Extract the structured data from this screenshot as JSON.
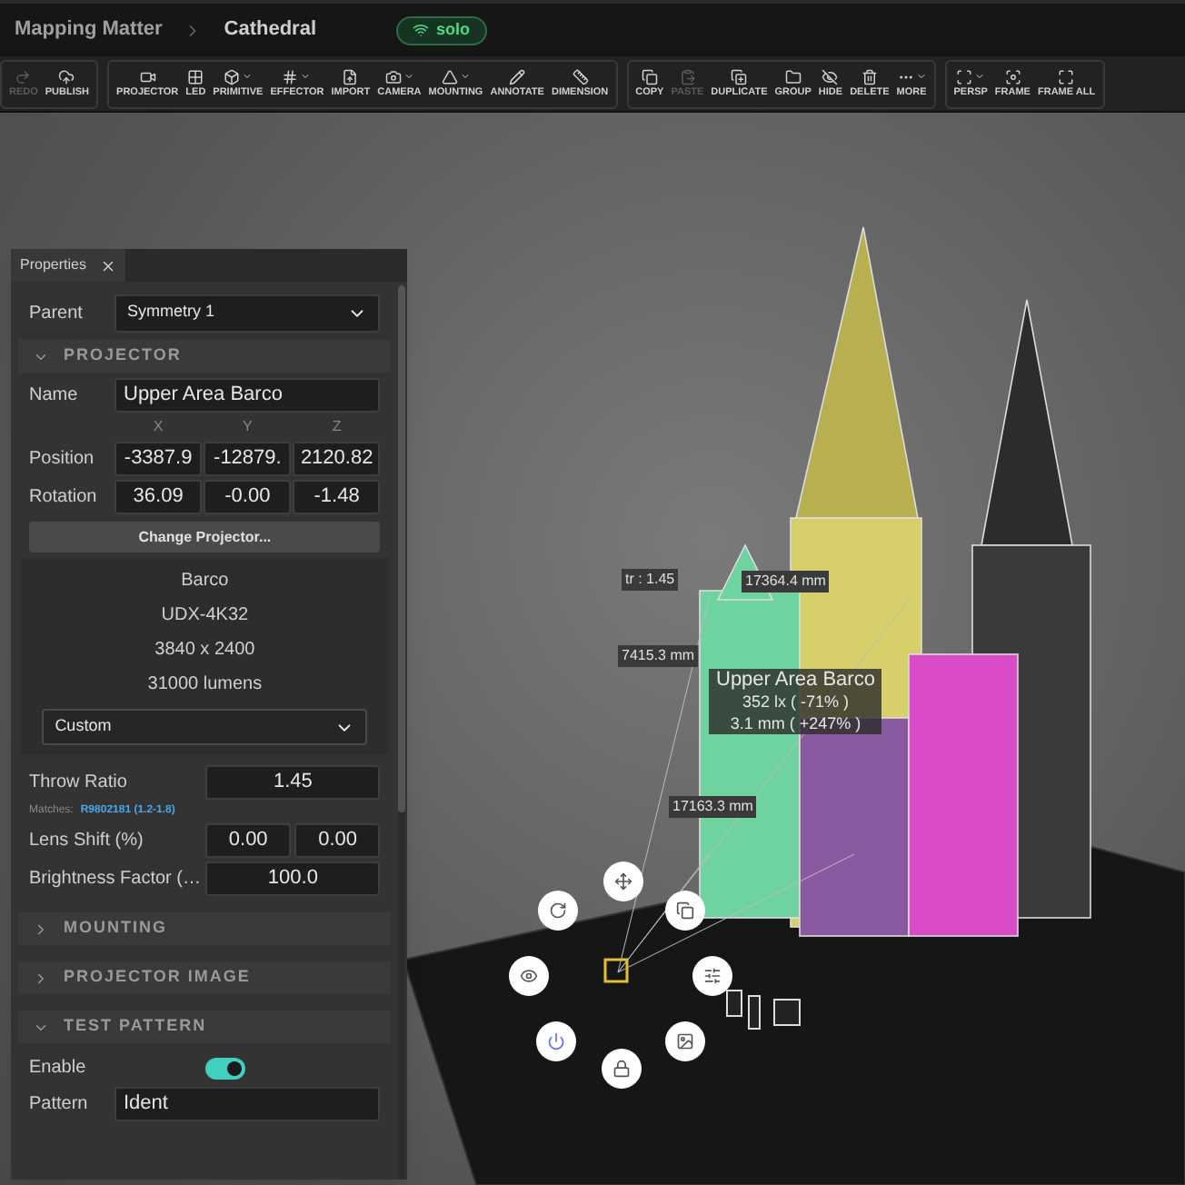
{
  "breadcrumb": [
    {
      "label": "Mapping Matter"
    },
    {
      "label": "Cathedral"
    }
  ],
  "status_badge": {
    "label": "solo"
  },
  "toolbar": {
    "groups": [
      [
        {
          "label": "REDO",
          "menu": false,
          "disabled": true
        },
        {
          "label": "PUBLISH",
          "menu": false,
          "disabled": false
        }
      ],
      [
        {
          "label": "PROJECTOR",
          "menu": false,
          "disabled": false
        },
        {
          "label": "LED",
          "menu": false,
          "disabled": false
        },
        {
          "label": "PRIMITIVE",
          "menu": true,
          "disabled": false
        },
        {
          "label": "EFFECTOR",
          "menu": true,
          "disabled": false
        },
        {
          "label": "IMPORT",
          "menu": false,
          "disabled": false
        },
        {
          "label": "CAMERA",
          "menu": true,
          "disabled": false
        },
        {
          "label": "MOUNTING",
          "menu": true,
          "disabled": false
        },
        {
          "label": "ANNOTATE",
          "menu": false,
          "disabled": false
        },
        {
          "label": "DIMENSION",
          "menu": false,
          "disabled": false
        }
      ],
      [
        {
          "label": "COPY",
          "menu": false,
          "disabled": false
        },
        {
          "label": "PASTE",
          "menu": false,
          "disabled": true
        },
        {
          "label": "DUPLICATE",
          "menu": false,
          "disabled": false
        },
        {
          "label": "GROUP",
          "menu": false,
          "disabled": false
        },
        {
          "label": "HIDE",
          "menu": false,
          "disabled": false
        },
        {
          "label": "DELETE",
          "menu": false,
          "disabled": false
        },
        {
          "label": "MORE",
          "menu": true,
          "disabled": false
        }
      ],
      [
        {
          "label": "PERSP",
          "menu": true,
          "disabled": false
        },
        {
          "label": "FRAME",
          "menu": false,
          "disabled": false
        },
        {
          "label": "FRAME ALL",
          "menu": false,
          "disabled": false
        }
      ]
    ]
  },
  "properties_panel": {
    "tab": "Properties",
    "parent": {
      "label": "Parent",
      "value": "Symmetry 1"
    },
    "projector": {
      "title": "PROJECTOR",
      "expanded": true,
      "name_label": "Name",
      "name": "Upper Area Barco",
      "axes": [
        "X",
        "Y",
        "Z"
      ],
      "position": {
        "label": "Position",
        "values": [
          "-3387.9",
          "-12879.",
          "2120.82"
        ]
      },
      "rotation": {
        "label": "Rotation",
        "values": [
          "36.09",
          "-0.00",
          "-1.48"
        ]
      },
      "change_button": "Change Projector...",
      "info": [
        "Barco",
        "UDX-4K32",
        "3840 x 2400",
        "31000 lumens"
      ],
      "lens": "Custom",
      "throw_ratio": {
        "label": "Throw Ratio",
        "value": "1.45"
      },
      "matches": {
        "label": "Matches:",
        "link": "R9802181 (1.2-1.8)"
      },
      "lens_shift": {
        "label": "Lens Shift (%)",
        "values": [
          "0.00",
          "0.00"
        ]
      },
      "brightness": {
        "label": "Brightness Factor (…",
        "value": "100.0"
      }
    },
    "sections": [
      {
        "title": "MOUNTING",
        "expanded": false
      },
      {
        "title": "PROJECTOR IMAGE",
        "expanded": false
      }
    ],
    "test_pattern": {
      "title": "TEST PATTERN",
      "expanded": true,
      "enable": {
        "label": "Enable",
        "on": true
      },
      "pattern": {
        "label": "Pattern",
        "value": "Ident"
      }
    }
  },
  "viewport": {
    "labels": [
      "tr : 1.45",
      "17364.4 mm",
      "7415.3 mm",
      "17163.3 mm"
    ],
    "tooltip": {
      "title": "Upper Area Barco",
      "lines": [
        "352 lx ( -71% )",
        "3.1 mm ( +247% )"
      ]
    }
  }
}
